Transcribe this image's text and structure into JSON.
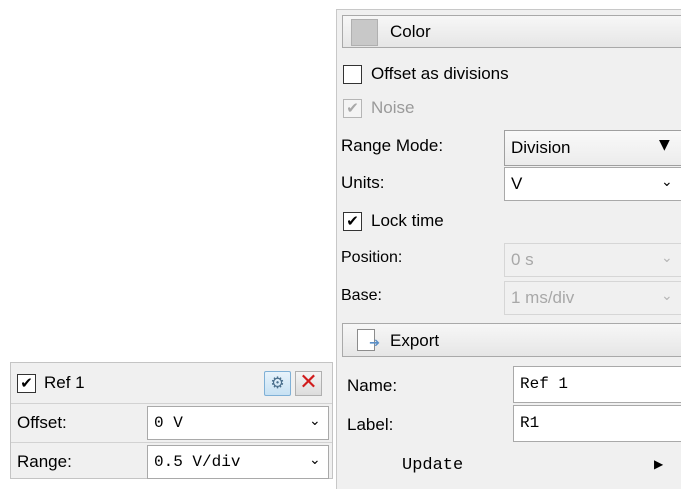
{
  "settings": {
    "color_label": "Color",
    "offset_as_divisions": {
      "label": "Offset as divisions",
      "checked": false
    },
    "noise": {
      "label": "Noise",
      "checked": true,
      "disabled": true
    },
    "range_mode": {
      "label": "Range Mode:",
      "value": "Division"
    },
    "units": {
      "label": "Units:",
      "value": "V"
    },
    "lock_time": {
      "label": "Lock time",
      "checked": true
    },
    "position": {
      "label": "Position:",
      "value": "0 s"
    },
    "base": {
      "label": "Base:",
      "value": "1 ms/div"
    },
    "export_label": "Export",
    "name": {
      "label": "Name:",
      "value": "Ref 1"
    },
    "label": {
      "label": "Label:",
      "value": "R1"
    },
    "update_label": "Update"
  },
  "reference": {
    "title": "Ref 1",
    "checked": true,
    "offset": {
      "label": "Offset:",
      "value": "0 V"
    },
    "range": {
      "label": "Range:",
      "value": "0.5 V/div"
    }
  },
  "icons": {
    "check": "checkmark-icon",
    "dropdown": "chevron-down-icon",
    "triangle": "triangle-down-icon",
    "submenu": "chevron-right-icon",
    "export": "document-export-icon",
    "gear": "gear-icon",
    "close": "close-icon"
  },
  "colors": {
    "swatch": "#c8c8c8",
    "close_red": "#d11c1c"
  }
}
